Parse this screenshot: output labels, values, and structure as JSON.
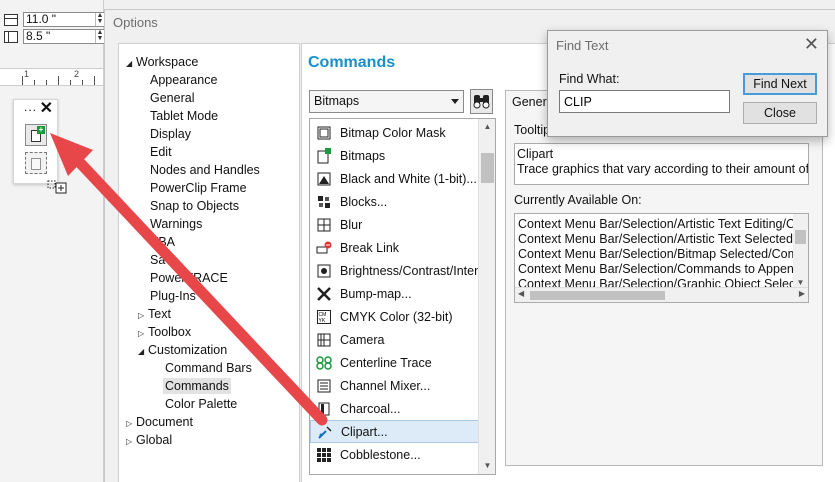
{
  "app": {
    "width_value": "11.0 \"",
    "height_value": "8.5 \"",
    "mini_panel_title": "...",
    "mini_panel_close": "✕",
    "ruler_labels": [
      "1",
      "2"
    ]
  },
  "options_dialog": {
    "title": "Options",
    "tree": [
      {
        "label": "Workspace",
        "toggle": "open"
      },
      {
        "label": "Appearance"
      },
      {
        "label": "General"
      },
      {
        "label": "Tablet Mode"
      },
      {
        "label": "Display"
      },
      {
        "label": "Edit"
      },
      {
        "label": "Nodes and Handles"
      },
      {
        "label": "PowerClip Frame"
      },
      {
        "label": "Snap to Objects"
      },
      {
        "label": "Warnings"
      },
      {
        "label": "VBA"
      },
      {
        "label": "Save"
      },
      {
        "label": "PowerTRACE"
      },
      {
        "label": "Plug-Ins"
      },
      {
        "label": "Text",
        "toggle": "closed"
      },
      {
        "label": "Toolbox",
        "toggle": "closed"
      },
      {
        "label": "Customization",
        "toggle": "open"
      },
      {
        "label": "Command Bars"
      },
      {
        "label": "Commands",
        "selected": true
      },
      {
        "label": "Color Palette"
      },
      {
        "label": "Document",
        "toggle": "closed"
      },
      {
        "label": "Global",
        "toggle": "closed"
      }
    ],
    "heading": "Commands",
    "category_select": "Bitmaps",
    "commands": [
      {
        "label": "Bitmap Color Mask",
        "icon": "bitmap-color-mask-icon"
      },
      {
        "label": "Bitmaps",
        "icon": "bitmaps-icon"
      },
      {
        "label": "Black and White (1-bit)...",
        "icon": "black-white-icon"
      },
      {
        "label": "Blocks...",
        "icon": "blocks-icon"
      },
      {
        "label": "Blur",
        "icon": "blur-icon"
      },
      {
        "label": "Break Link",
        "icon": "break-link-icon"
      },
      {
        "label": "Brightness/Contrast/Intensity...",
        "icon": "brightness-icon"
      },
      {
        "label": "Bump-map...",
        "icon": "bump-map-icon"
      },
      {
        "label": "CMYK Color (32-bit)",
        "icon": "cmyk-icon"
      },
      {
        "label": "Camera",
        "icon": "camera-icon"
      },
      {
        "label": "Centerline Trace",
        "icon": "centerline-trace-icon"
      },
      {
        "label": "Channel Mixer...",
        "icon": "channel-mixer-icon"
      },
      {
        "label": "Charcoal...",
        "icon": "charcoal-icon"
      },
      {
        "label": "Clipart...",
        "icon": "clipart-icon",
        "selected": true
      },
      {
        "label": "Cobblestone...",
        "icon": "cobblestone-icon"
      }
    ],
    "details": {
      "tab": "General",
      "tooltip_label": "Tooltip",
      "tooltip_lines": [
        "Clipart",
        "Trace graphics that vary according to their amount of d"
      ],
      "available_label": "Currently Available On:",
      "available_on": [
        "Context Menu Bar/Selection/Artistic Text Editing/Co",
        "Context Menu Bar/Selection/Artistic Text Selected/C",
        "Context Menu Bar/Selection/Bitmap Selected/Comm",
        "Context Menu Bar/Selection/Commands to Append",
        "Context Menu Bar/Selection/Graphic Object Selectio"
      ]
    }
  },
  "find_dialog": {
    "title": "Find Text",
    "label": "Find What:",
    "value": "CLIP",
    "find_next": "Find Next",
    "close": "Close"
  },
  "colors": {
    "heading": "#1a8fc9",
    "selection": "#dcebf7",
    "annotation_arrow": "#e8474a"
  }
}
